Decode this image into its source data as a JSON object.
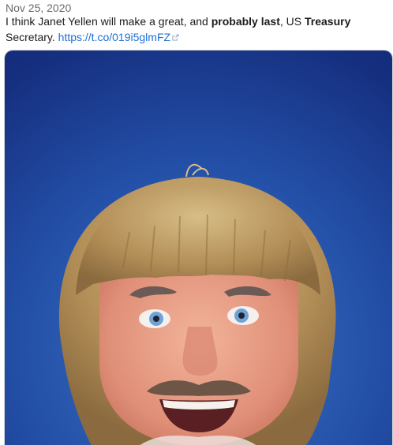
{
  "tweet": {
    "date": "Nov 25, 2020",
    "text_part1": "I think Janet Yellen will make a great, and ",
    "text_bold1": "probably last",
    "text_part2": ", US ",
    "text_bold2": "Treasury",
    "text_part3": "Secretary. ",
    "link": "https://t.co/019i5glmFZ",
    "link_icon": "external-link-icon"
  },
  "media": {
    "icon": "photo",
    "colors": {
      "background": "#1c3f9c",
      "hair": "#b48f58",
      "skin": "#e79a80",
      "mustache": "#6d5646"
    }
  }
}
